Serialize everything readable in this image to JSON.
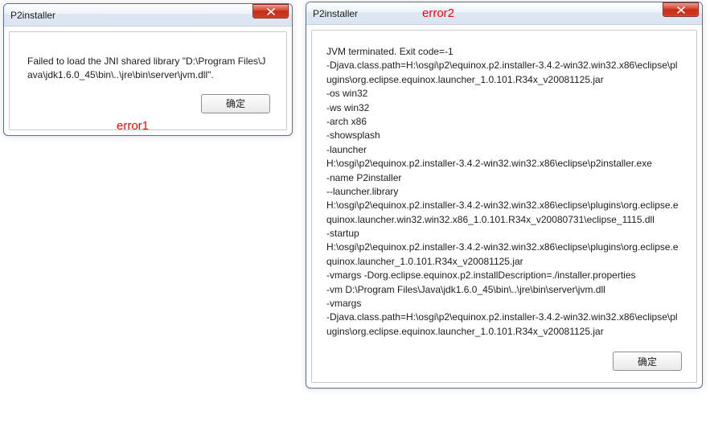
{
  "dialog1": {
    "title": "P2installer",
    "message": "Failed to load the JNI shared library \"D:\\Program Files\\Java\\jdk1.6.0_45\\bin\\..\\jre\\bin\\server\\jvm.dll\".",
    "ok_label": "确定",
    "annotation": "error1"
  },
  "dialog2": {
    "title": "P2installer",
    "message_lines": [
      "JVM terminated. Exit code=-1",
      "-Djava.class.path=H:\\osgi\\p2\\equinox.p2.installer-3.4.2-win32.win32.x86\\eclipse\\plugins\\org.eclipse.equinox.launcher_1.0.101.R34x_v20081125.jar",
      "-os win32",
      "-ws win32",
      "-arch x86",
      "-showsplash",
      "-launcher",
      "H:\\osgi\\p2\\equinox.p2.installer-3.4.2-win32.win32.x86\\eclipse\\p2installer.exe",
      "-name P2installer",
      "--launcher.library",
      "H:\\osgi\\p2\\equinox.p2.installer-3.4.2-win32.win32.x86\\eclipse\\plugins\\org.eclipse.equinox.launcher.win32.win32.x86_1.0.101.R34x_v20080731\\eclipse_1115.dll",
      "-startup",
      "H:\\osgi\\p2\\equinox.p2.installer-3.4.2-win32.win32.x86\\eclipse\\plugins\\org.eclipse.equinox.launcher_1.0.101.R34x_v20081125.jar",
      "-vmargs -Dorg.eclipse.equinox.p2.installDescription=./installer.properties",
      "-vm D:\\Program Files\\Java\\jdk1.6.0_45\\bin\\..\\jre\\bin\\server\\jvm.dll",
      "-vmargs",
      "-Djava.class.path=H:\\osgi\\p2\\equinox.p2.installer-3.4.2-win32.win32.x86\\eclipse\\plugins\\org.eclipse.equinox.launcher_1.0.101.R34x_v20081125.jar"
    ],
    "ok_label": "确定",
    "annotation": "error2"
  }
}
